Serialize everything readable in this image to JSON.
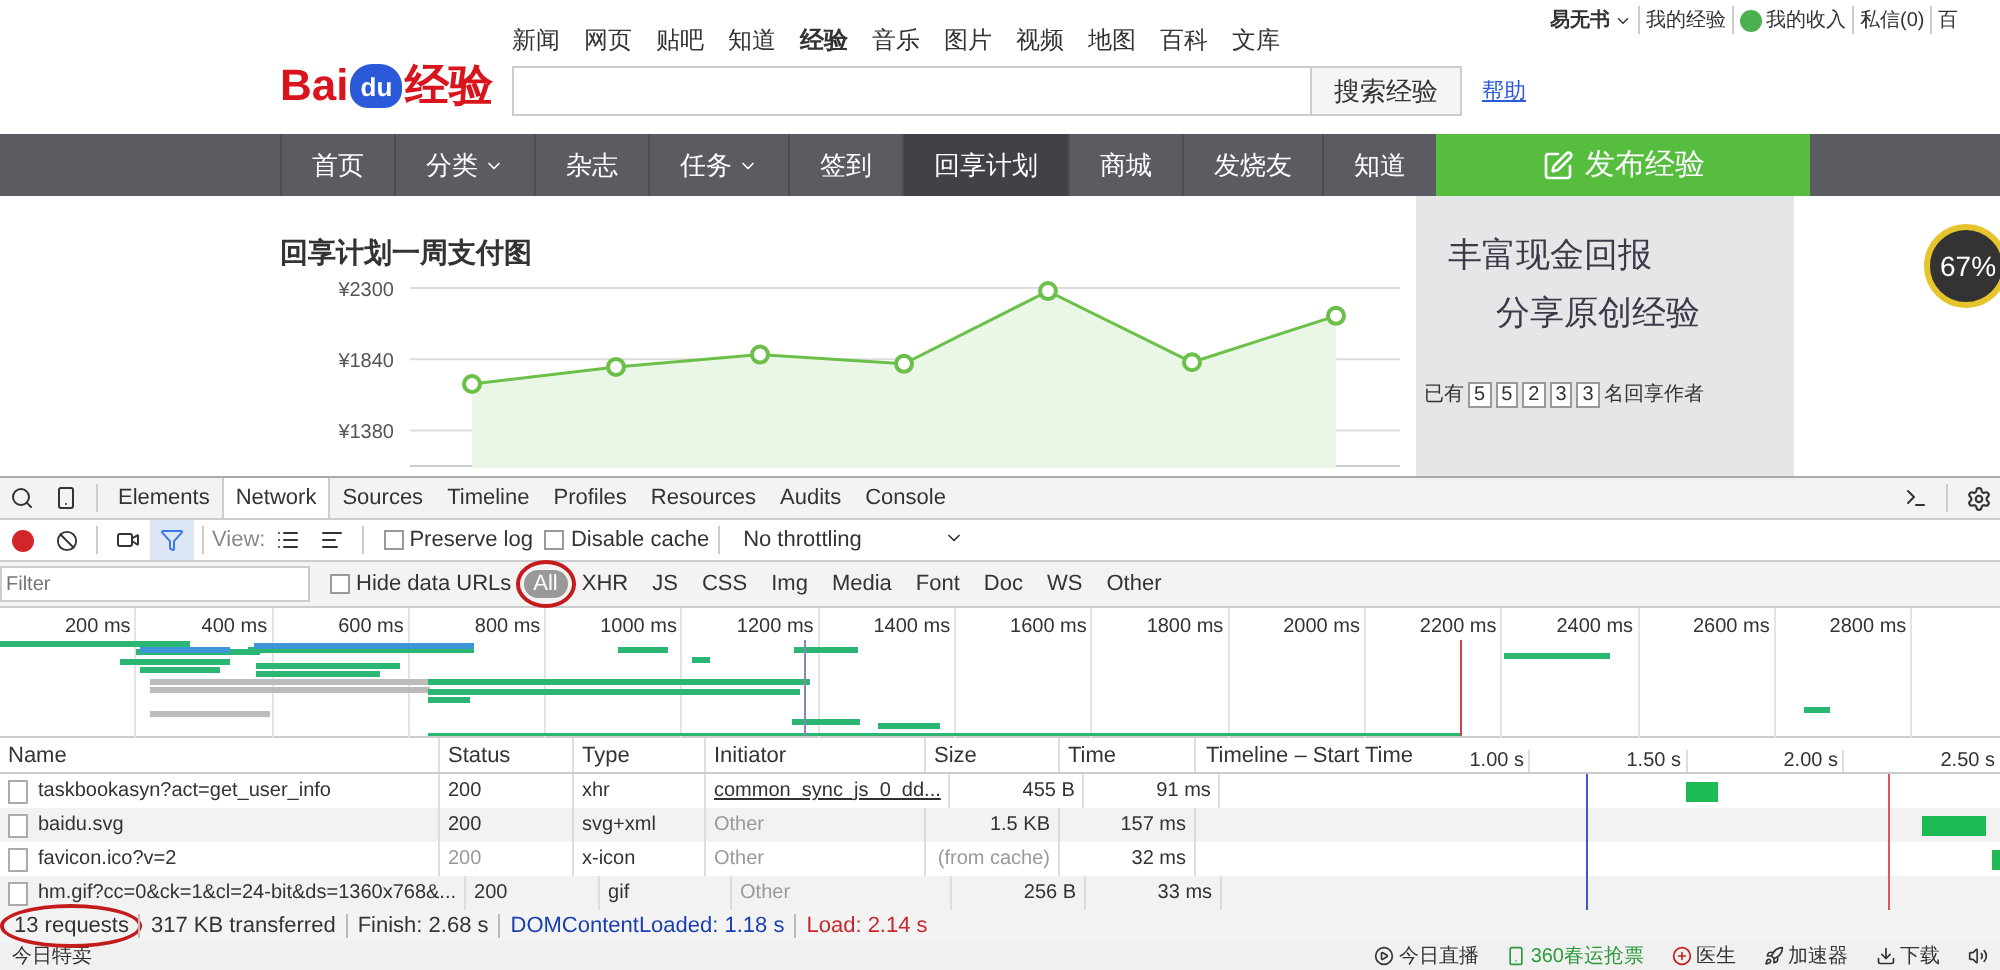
{
  "header": {
    "logo": {
      "part_1": "Bai",
      "part_2": "du",
      "part_3": "经验"
    },
    "top_links": [
      {
        "label": "新闻",
        "selected": false
      },
      {
        "label": "网页",
        "selected": false
      },
      {
        "label": "贴吧",
        "selected": false
      },
      {
        "label": "知道",
        "selected": false
      },
      {
        "label": "经验",
        "selected": true
      },
      {
        "label": "音乐",
        "selected": false
      },
      {
        "label": "图片",
        "selected": false
      },
      {
        "label": "视频",
        "selected": false
      },
      {
        "label": "地图",
        "selected": false
      },
      {
        "label": "百科",
        "selected": false
      },
      {
        "label": "文库",
        "selected": false
      }
    ],
    "search": {
      "button": "搜索经验",
      "help": "帮助"
    },
    "user_links": [
      {
        "label": "易无书",
        "kind": "user"
      },
      {
        "label": "我的经验",
        "kind": "link"
      },
      {
        "label": "我的收入",
        "kind": "money"
      },
      {
        "label": "私信(0)",
        "kind": "link"
      },
      {
        "label": "百",
        "kind": "link"
      }
    ]
  },
  "nav": {
    "items": [
      {
        "label": "首页",
        "dropdown": false,
        "selected": false
      },
      {
        "label": "分类",
        "dropdown": true,
        "selected": false
      },
      {
        "label": "杂志",
        "dropdown": false,
        "selected": false
      },
      {
        "label": "任务",
        "dropdown": true,
        "selected": false
      },
      {
        "label": "签到",
        "dropdown": false,
        "selected": false
      },
      {
        "label": "回享计划",
        "dropdown": false,
        "selected": true
      },
      {
        "label": "商城",
        "dropdown": false,
        "selected": false
      },
      {
        "label": "发烧友",
        "dropdown": false,
        "selected": false
      },
      {
        "label": "知道",
        "dropdown": false,
        "selected": false
      }
    ],
    "publish_button": "发布经验"
  },
  "content": {
    "chart_data": {
      "type": "area",
      "title": "回享计划一周支付图",
      "series": [
        {
          "color": "#6cc04a",
          "values": [
            1680,
            1790,
            1870,
            1810,
            2280,
            1820,
            2120
          ]
        }
      ],
      "grid": true,
      "ylim": [
        1150,
        2300
      ],
      "yticks": [
        {
          "value": 2300,
          "label": "¥2300"
        },
        {
          "value": 1840,
          "label": "¥1840"
        },
        {
          "value": 1380,
          "label": "¥1380"
        }
      ]
    },
    "banner": {
      "line_1": "丰富现金回报",
      "line_2": "分享原创经验",
      "count_prefix": "已有",
      "count_digits": [
        "5",
        "5",
        "2",
        "3",
        "3"
      ],
      "count_suffix": "名回享作者"
    },
    "badge": "67%"
  },
  "devtools": {
    "tabs": [
      {
        "label": "Elements",
        "selected": false
      },
      {
        "label": "Network",
        "selected": true
      },
      {
        "label": "Sources",
        "selected": false
      },
      {
        "label": "Timeline",
        "selected": false
      },
      {
        "label": "Profiles",
        "selected": false
      },
      {
        "label": "Resources",
        "selected": false
      },
      {
        "label": "Audits",
        "selected": false
      },
      {
        "label": "Console",
        "selected": false
      }
    ],
    "toolbar": {
      "view_label": "View:",
      "preserve_log": {
        "label": "Preserve log",
        "checked": false
      },
      "disable_cache": {
        "label": "Disable cache",
        "checked": false
      },
      "throttling": "No throttling"
    },
    "filter": {
      "placeholder": "Filter",
      "hide_data_urls": {
        "label": "Hide data URLs",
        "checked": false
      },
      "types": [
        {
          "label": "All",
          "selected": true,
          "circled": true
        },
        {
          "label": "XHR",
          "selected": false,
          "circled": false
        },
        {
          "label": "JS",
          "selected": false,
          "circled": false
        },
        {
          "label": "CSS",
          "selected": false,
          "circled": false
        },
        {
          "label": "Img",
          "selected": false,
          "circled": false
        },
        {
          "label": "Media",
          "selected": false,
          "circled": false
        },
        {
          "label": "Font",
          "selected": false,
          "circled": false
        },
        {
          "label": "Doc",
          "selected": false,
          "circled": false
        },
        {
          "label": "WS",
          "selected": false,
          "circled": false
        },
        {
          "label": "Other",
          "selected": false,
          "circled": false
        }
      ]
    },
    "overview_ticks": [
      "200 ms",
      "400 ms",
      "600 ms",
      "800 ms",
      "1000 ms",
      "1200 ms",
      "1400 ms",
      "1600 ms",
      "1800 ms",
      "2000 ms",
      "2200 ms",
      "2400 ms",
      "2600 ms",
      "2800 ms"
    ],
    "table": {
      "columns": [
        "Name",
        "Status",
        "Type",
        "Initiator",
        "Size",
        "Time",
        "Timeline – Start Time"
      ],
      "timeline_ticks": [
        "1.00 s",
        "1.50 s",
        "2.00 s",
        "2.50 s"
      ],
      "rows": [
        {
          "name": "taskbookasyn?act=get_user_info",
          "status": "200",
          "status_dimmed": false,
          "type": "xhr",
          "initiator": "common_sync_js_0_dd...",
          "initiator_link": true,
          "size": "455 B",
          "size_dimmed": false,
          "time": "91 ms"
        },
        {
          "name": "baidu.svg",
          "status": "200",
          "status_dimmed": false,
          "type": "svg+xml",
          "initiator": "Other",
          "initiator_link": false,
          "size": "1.5 KB",
          "size_dimmed": false,
          "time": "157 ms"
        },
        {
          "name": "favicon.ico?v=2",
          "status": "200",
          "status_dimmed": true,
          "type": "x-icon",
          "initiator": "Other",
          "initiator_link": false,
          "size": "(from cache)",
          "size_dimmed": true,
          "time": "32 ms"
        },
        {
          "name": "hm.gif?cc=0&ck=1&cl=24-bit&ds=1360x768&...",
          "status": "200",
          "status_dimmed": false,
          "type": "gif",
          "initiator": "Other",
          "initiator_link": false,
          "size": "256 B",
          "size_dimmed": false,
          "time": "33 ms"
        }
      ]
    },
    "status_bar": [
      {
        "text": "13 requests",
        "color": "#333333",
        "circled": true
      },
      {
        "text": "317 KB transferred",
        "color": "#333333",
        "circled": false
      },
      {
        "text": "Finish: 2.68 s",
        "color": "#333333",
        "circled": false
      },
      {
        "text": "DOMContentLoaded: 1.18 s",
        "color": "#1a3eb0",
        "circled": false
      },
      {
        "text": "Load: 2.14 s",
        "color": "#c8282c",
        "circled": false
      }
    ]
  },
  "taskbar": {
    "left": "今日特卖",
    "right": [
      {
        "label": "今日直播",
        "kind": "play"
      },
      {
        "label": "360春运抢票",
        "kind": "phone"
      },
      {
        "label": "医生",
        "kind": "doctor"
      },
      {
        "label": "加速器",
        "kind": "rocket"
      },
      {
        "label": "下载",
        "kind": "download"
      }
    ]
  }
}
